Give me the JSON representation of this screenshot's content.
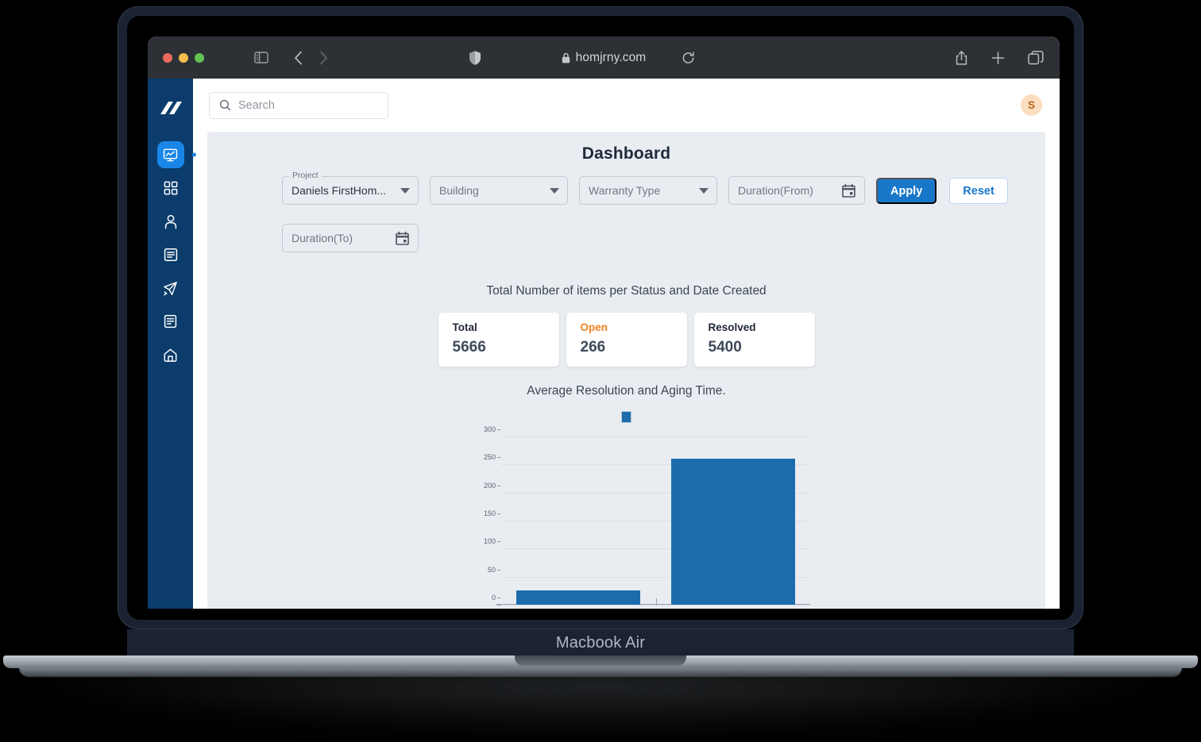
{
  "device": {
    "label": "Macbook Air"
  },
  "browser": {
    "url": "homjrny.com",
    "lock_icon": "lock-icon",
    "shield_icon": "shield-icon",
    "reload_icon": "reload-icon",
    "sidebar_icon": "sidebar-toggle-icon",
    "back_icon": "back-chevron-icon",
    "forward_icon": "forward-chevron-icon",
    "share_icon": "share-icon",
    "new_tab_icon": "plus-icon",
    "tabs_icon": "tab-overview-icon"
  },
  "sidebar": {
    "logo": "homjrny-logo",
    "items": [
      {
        "icon": "dashboard-monitor-icon",
        "label": "Dashboard",
        "active": true
      },
      {
        "icon": "apps-grid-icon",
        "label": "Apps",
        "active": false
      },
      {
        "icon": "user-icon",
        "label": "Users",
        "active": false
      },
      {
        "icon": "list-icon",
        "label": "Items",
        "active": false
      },
      {
        "icon": "paper-plane-icon",
        "label": "Send",
        "active": false
      },
      {
        "icon": "document-icon",
        "label": "Documents",
        "active": false
      },
      {
        "icon": "home-icon",
        "label": "Home",
        "active": false
      }
    ]
  },
  "topbar": {
    "search_placeholder": "Search",
    "search_value": "",
    "search_icon": "search-icon",
    "avatar_initial": "S"
  },
  "page": {
    "title": "Dashboard"
  },
  "filters": {
    "project": {
      "legend": "Project",
      "value": "Daniels FirstHom..."
    },
    "building": {
      "placeholder": "Building"
    },
    "warranty": {
      "placeholder": "Warranty Type"
    },
    "duration_from": {
      "placeholder": "Duration(From)",
      "icon": "calendar-icon"
    },
    "duration_to": {
      "placeholder": "Duration(To)",
      "icon": "calendar-icon"
    },
    "apply_label": "Apply",
    "reset_label": "Reset"
  },
  "stats": {
    "heading": "Total Number of items per Status and Date Created",
    "cards": [
      {
        "label": "Total",
        "value": "5666",
        "color": "#1f2835"
      },
      {
        "label": "Open",
        "value": "266",
        "color": "#f08020"
      },
      {
        "label": "Resolved",
        "value": "5400",
        "color": "#1f2835"
      }
    ]
  },
  "chart_data": {
    "type": "bar",
    "title": "Average Resolution and Aging Time.",
    "categories": [
      "",
      ""
    ],
    "values": [
      25,
      260
    ],
    "series": [
      {
        "name": "",
        "color": "#1c6cab",
        "values": [
          25,
          260
        ]
      }
    ],
    "xlabel": "",
    "ylabel": "",
    "ylim": [
      0,
      300
    ],
    "yticks": [
      "0",
      "50",
      "100",
      "150",
      "200",
      "250",
      "300"
    ],
    "grid": true,
    "legend_position": "top",
    "legend": [
      {
        "label": "",
        "color": "#1c6cab"
      }
    ]
  },
  "colors": {
    "sidebar": "#0b3c6b",
    "accent": "#1877c9",
    "active": "#1a86e8",
    "panel": "#e9edf2",
    "bar": "#1c6cab",
    "open": "#f08020"
  }
}
